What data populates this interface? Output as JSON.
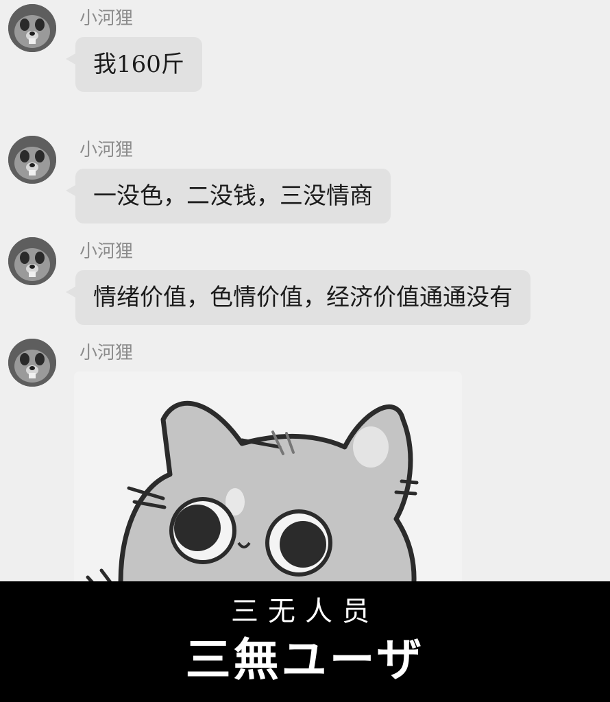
{
  "messages": [
    {
      "sender": "小河狸",
      "text": "我160斤"
    },
    {
      "sender": "小河狸",
      "text": "一没色，二没钱，三没情商"
    },
    {
      "sender": "小河狸",
      "text": "情绪价值，色情价值，经济价值通通没有"
    },
    {
      "sender": "小河狸",
      "type": "sticker",
      "sticker_icon": "cat-face-sticker"
    }
  ],
  "avatar_icon": "beaver-avatar",
  "subtitle": {
    "chinese": "三无人员",
    "japanese": "三無ユーザ"
  },
  "colors": {
    "background": "#efefef",
    "bubble": "#e1e1e1",
    "caption_bar": "#000000",
    "caption_text": "#ffffff"
  }
}
